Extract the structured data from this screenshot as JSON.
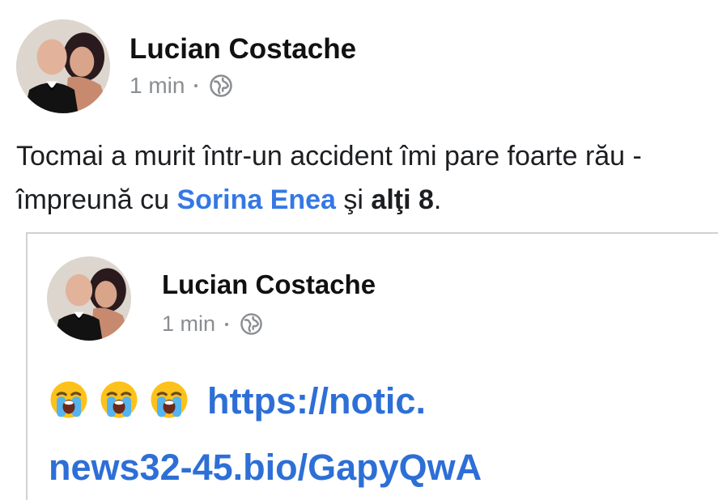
{
  "post": {
    "author": "Lucian Costache",
    "time": "1 min",
    "audience_icon": "globe-icon",
    "message_text": "Tocmai a murit într-un accident îmi pare foarte rău - împreună cu ",
    "mention": "Sorina Enea",
    "conjunction": " şi ",
    "others": "alţi 8",
    "period": "."
  },
  "shared_post": {
    "author": "Lucian Costache",
    "time": "1 min",
    "audience_icon": "globe-icon",
    "emojis": [
      "loudly-crying-face-icon",
      "loudly-crying-face-icon",
      "loudly-crying-face-icon"
    ],
    "link_line1": "https://notic.",
    "link_line2": "news32-45.bio/GapyQwA"
  },
  "colors": {
    "mention": "#3578e5",
    "link": "#2d6fd6",
    "meta": "#8a8d91",
    "border": "#cfd1d5"
  }
}
